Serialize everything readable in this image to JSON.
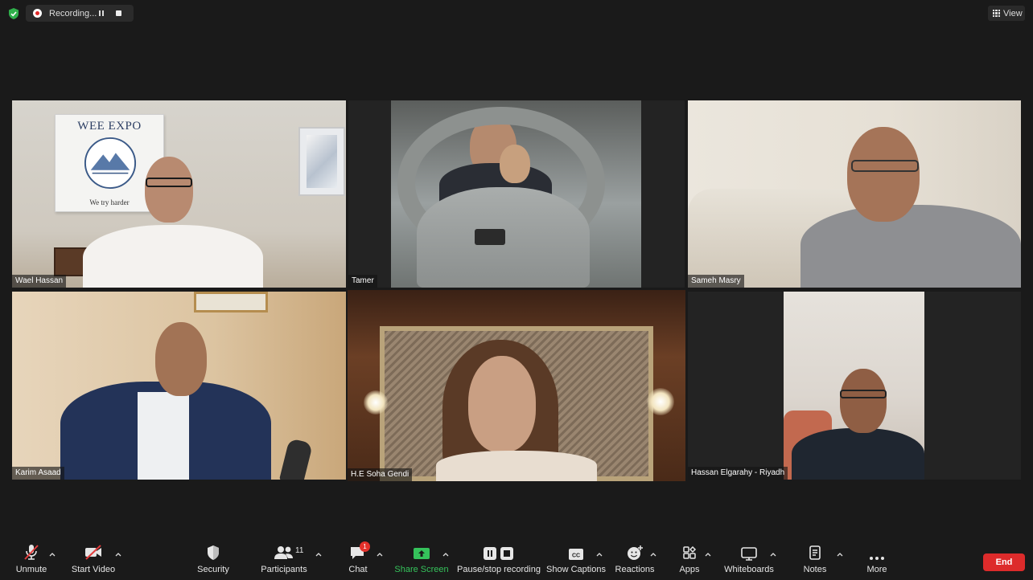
{
  "recording": {
    "label": "Recording..."
  },
  "view": {
    "label": "View"
  },
  "participants_tiles": [
    {
      "name": "Wael Hassan"
    },
    {
      "name": "Tamer"
    },
    {
      "name": "Sameh Masry"
    },
    {
      "name": "Karim Asaad"
    },
    {
      "name": "H.E Soha Gendi"
    },
    {
      "name": "Hassan Elgarahy - Riyadh"
    }
  ],
  "background_sign": {
    "title": "WEE EXPO",
    "tagline": "We try harder"
  },
  "toolbar": {
    "unmute": "Unmute",
    "start_video": "Start Video",
    "security": "Security",
    "participants": "Participants",
    "participants_count": "11",
    "chat": "Chat",
    "chat_badge": "1",
    "share_screen": "Share Screen",
    "pause_recording": "Pause/stop recording",
    "show_captions": "Show Captions",
    "reactions": "Reactions",
    "apps": "Apps",
    "whiteboards": "Whiteboards",
    "notes": "Notes",
    "more": "More",
    "end": "End"
  },
  "colors": {
    "accent_green": "#35c25b",
    "end_red": "#dd2b2b",
    "active_speaker": "#d9e86a"
  }
}
